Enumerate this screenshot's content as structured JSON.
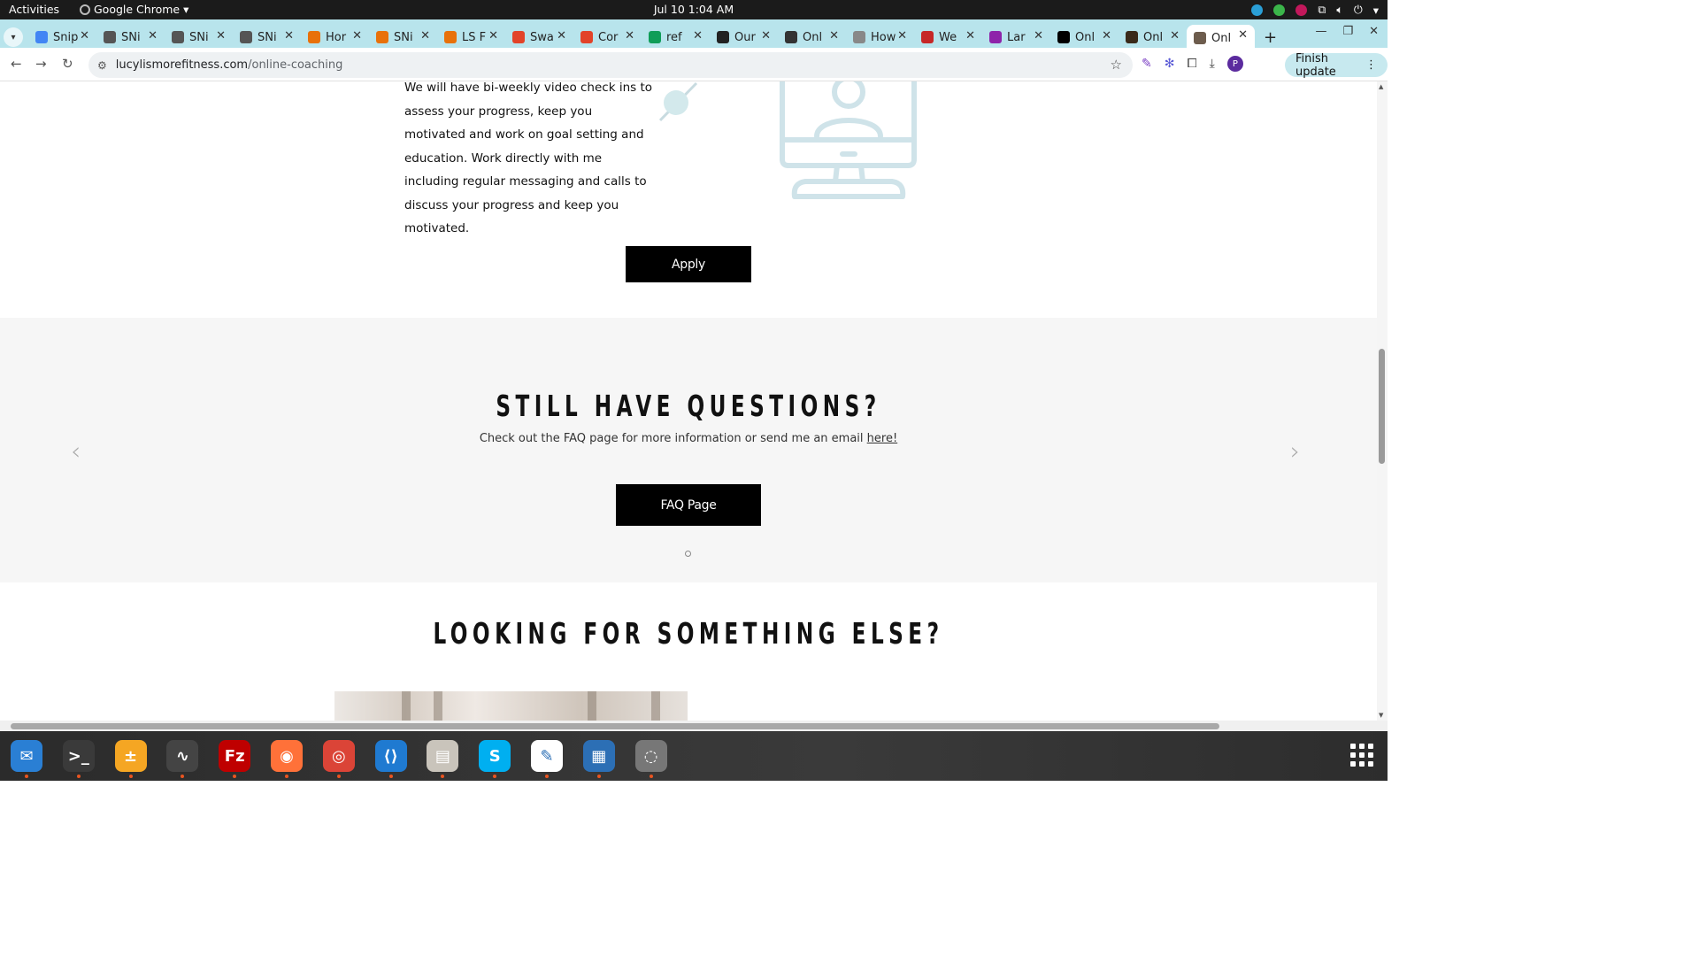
{
  "system": {
    "activities": "Activities",
    "app_name": "Google Chrome",
    "clock": "Jul 10  1:04 AM"
  },
  "tabs": [
    {
      "label": "Snip",
      "color": "#4285f4"
    },
    {
      "label": "SNi",
      "color": "#555555"
    },
    {
      "label": "SNi",
      "color": "#555555"
    },
    {
      "label": "SNi",
      "color": "#555555"
    },
    {
      "label": "Hor",
      "color": "#e8710a"
    },
    {
      "label": "SNi",
      "color": "#e8710a"
    },
    {
      "label": "LS F",
      "color": "#e8710a"
    },
    {
      "label": "Swa",
      "color": "#e24329"
    },
    {
      "label": "Cor",
      "color": "#e24329"
    },
    {
      "label": "ref",
      "color": "#0f9d58"
    },
    {
      "label": "Our",
      "color": "#222222"
    },
    {
      "label": "Onl",
      "color": "#333333"
    },
    {
      "label": "How",
      "color": "#888888"
    },
    {
      "label": "We",
      "color": "#c62828"
    },
    {
      "label": "Lar",
      "color": "#8e24aa"
    },
    {
      "label": "Onl",
      "color": "#000000"
    },
    {
      "label": "Onl",
      "color": "#3a2a1a"
    },
    {
      "label": "Onl",
      "color": "#6d5c4d",
      "active": true
    }
  ],
  "toolbar": {
    "url_host": "lucylismorefitness.com",
    "url_path": "/online-coaching",
    "avatar_letter": "P",
    "finish_update": "Finish update"
  },
  "page": {
    "body_text": "We will have bi-weekly video check ins to assess your progress, keep you motivated and work on goal setting and education. Work directly with me including regular messaging and calls to discuss your progress and keep you motivated.",
    "apply_label": "Apply",
    "faq_heading": "STILL HAVE QUESTIONS?",
    "faq_sub_text": "Check out the FAQ page for more information or send me an email ",
    "faq_sub_link": "here!",
    "faq_button": "FAQ Page",
    "else_heading": "LOOKING FOR SOMETHING ELSE?"
  },
  "dock": [
    {
      "name": "thunderbird-icon",
      "color": "#2a7fd4",
      "glyph": "✉"
    },
    {
      "name": "terminal-icon",
      "color": "#3a3a3a",
      "glyph": ">_"
    },
    {
      "name": "calculator-icon",
      "color": "#f5a623",
      "glyph": "±"
    },
    {
      "name": "system-monitor-icon",
      "color": "#444444",
      "glyph": "∿"
    },
    {
      "name": "filezilla-icon",
      "color": "#bf0000",
      "glyph": "Fz"
    },
    {
      "name": "firefox-icon",
      "color": "#ff7139",
      "glyph": "◉"
    },
    {
      "name": "chrome-icon",
      "color": "#db4437",
      "glyph": "◎"
    },
    {
      "name": "vscode-icon",
      "color": "#1f7ad1",
      "glyph": "⟨⟩"
    },
    {
      "name": "files-icon",
      "color": "#c9c4bb",
      "glyph": "▤"
    },
    {
      "name": "skype-icon",
      "color": "#00aff0",
      "glyph": "S"
    },
    {
      "name": "text-editor-icon",
      "color": "#ffffff",
      "glyph": "✎"
    },
    {
      "name": "document-viewer-icon",
      "color": "#2c6fb5",
      "glyph": "▦"
    },
    {
      "name": "disk-icon",
      "color": "#777777",
      "glyph": "◌"
    }
  ]
}
